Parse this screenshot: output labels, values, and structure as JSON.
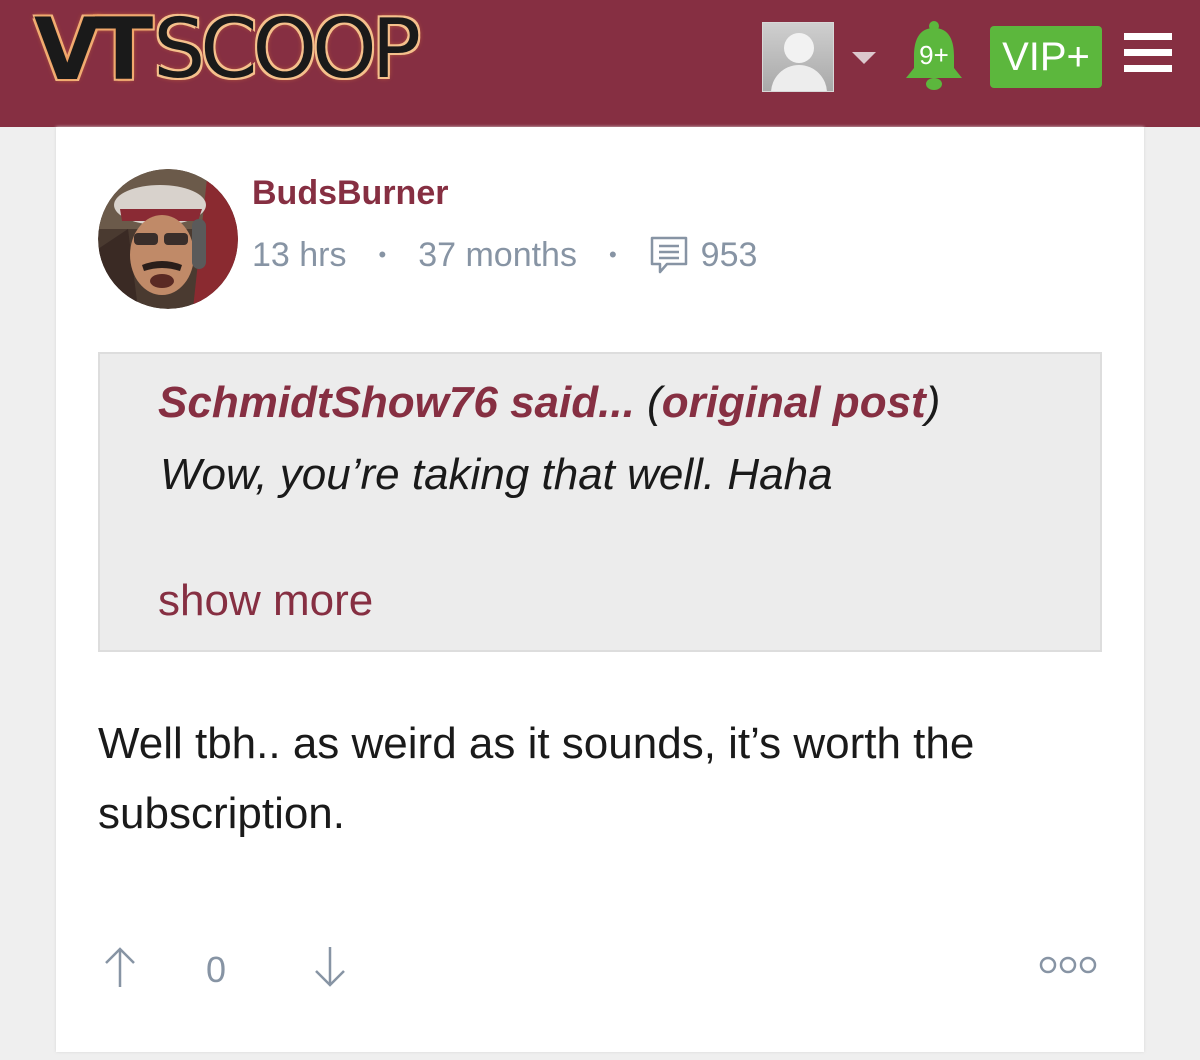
{
  "header": {
    "logo_vt": "VT",
    "logo_scoop": "SCOOP",
    "notification_count": "9+",
    "vip_label": "VIP+"
  },
  "post": {
    "username": "BudsBurner",
    "time_ago": "13 hrs",
    "member_for": "37 months",
    "post_count": "953",
    "quote": {
      "author": "SchmidtShow76",
      "said": "said...",
      "paren_open": "(",
      "link_label": "original post",
      "paren_close": ")",
      "text": "Wow, you’re taking that well. Haha",
      "show_more": "show more"
    },
    "body_line1": "Well tbh.. as weird as it sounds, it’s worth the",
    "body_line2": "subscription.",
    "vote_score": "0"
  },
  "colors": {
    "brand": "#862f42",
    "vip_green": "#5cb73d",
    "meta_gray": "#8794a4"
  },
  "icons": [
    "user-placeholder-icon",
    "caret-down-icon",
    "bell-icon",
    "menu-icon",
    "comment-icon",
    "arrow-up-icon",
    "arrow-down-icon",
    "more-icon"
  ]
}
